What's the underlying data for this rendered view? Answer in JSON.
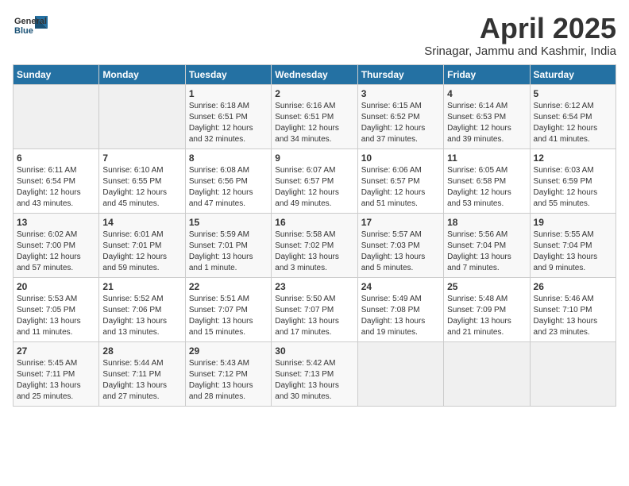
{
  "logo": {
    "general": "General",
    "blue": "Blue"
  },
  "title": "April 2025",
  "location": "Srinagar, Jammu and Kashmir, India",
  "weekdays": [
    "Sunday",
    "Monday",
    "Tuesday",
    "Wednesday",
    "Thursday",
    "Friday",
    "Saturday"
  ],
  "weeks": [
    [
      {
        "day": "",
        "detail": ""
      },
      {
        "day": "",
        "detail": ""
      },
      {
        "day": "1",
        "detail": "Sunrise: 6:18 AM\nSunset: 6:51 PM\nDaylight: 12 hours\nand 32 minutes."
      },
      {
        "day": "2",
        "detail": "Sunrise: 6:16 AM\nSunset: 6:51 PM\nDaylight: 12 hours\nand 34 minutes."
      },
      {
        "day": "3",
        "detail": "Sunrise: 6:15 AM\nSunset: 6:52 PM\nDaylight: 12 hours\nand 37 minutes."
      },
      {
        "day": "4",
        "detail": "Sunrise: 6:14 AM\nSunset: 6:53 PM\nDaylight: 12 hours\nand 39 minutes."
      },
      {
        "day": "5",
        "detail": "Sunrise: 6:12 AM\nSunset: 6:54 PM\nDaylight: 12 hours\nand 41 minutes."
      }
    ],
    [
      {
        "day": "6",
        "detail": "Sunrise: 6:11 AM\nSunset: 6:54 PM\nDaylight: 12 hours\nand 43 minutes."
      },
      {
        "day": "7",
        "detail": "Sunrise: 6:10 AM\nSunset: 6:55 PM\nDaylight: 12 hours\nand 45 minutes."
      },
      {
        "day": "8",
        "detail": "Sunrise: 6:08 AM\nSunset: 6:56 PM\nDaylight: 12 hours\nand 47 minutes."
      },
      {
        "day": "9",
        "detail": "Sunrise: 6:07 AM\nSunset: 6:57 PM\nDaylight: 12 hours\nand 49 minutes."
      },
      {
        "day": "10",
        "detail": "Sunrise: 6:06 AM\nSunset: 6:57 PM\nDaylight: 12 hours\nand 51 minutes."
      },
      {
        "day": "11",
        "detail": "Sunrise: 6:05 AM\nSunset: 6:58 PM\nDaylight: 12 hours\nand 53 minutes."
      },
      {
        "day": "12",
        "detail": "Sunrise: 6:03 AM\nSunset: 6:59 PM\nDaylight: 12 hours\nand 55 minutes."
      }
    ],
    [
      {
        "day": "13",
        "detail": "Sunrise: 6:02 AM\nSunset: 7:00 PM\nDaylight: 12 hours\nand 57 minutes."
      },
      {
        "day": "14",
        "detail": "Sunrise: 6:01 AM\nSunset: 7:01 PM\nDaylight: 12 hours\nand 59 minutes."
      },
      {
        "day": "15",
        "detail": "Sunrise: 5:59 AM\nSunset: 7:01 PM\nDaylight: 13 hours\nand 1 minute."
      },
      {
        "day": "16",
        "detail": "Sunrise: 5:58 AM\nSunset: 7:02 PM\nDaylight: 13 hours\nand 3 minutes."
      },
      {
        "day": "17",
        "detail": "Sunrise: 5:57 AM\nSunset: 7:03 PM\nDaylight: 13 hours\nand 5 minutes."
      },
      {
        "day": "18",
        "detail": "Sunrise: 5:56 AM\nSunset: 7:04 PM\nDaylight: 13 hours\nand 7 minutes."
      },
      {
        "day": "19",
        "detail": "Sunrise: 5:55 AM\nSunset: 7:04 PM\nDaylight: 13 hours\nand 9 minutes."
      }
    ],
    [
      {
        "day": "20",
        "detail": "Sunrise: 5:53 AM\nSunset: 7:05 PM\nDaylight: 13 hours\nand 11 minutes."
      },
      {
        "day": "21",
        "detail": "Sunrise: 5:52 AM\nSunset: 7:06 PM\nDaylight: 13 hours\nand 13 minutes."
      },
      {
        "day": "22",
        "detail": "Sunrise: 5:51 AM\nSunset: 7:07 PM\nDaylight: 13 hours\nand 15 minutes."
      },
      {
        "day": "23",
        "detail": "Sunrise: 5:50 AM\nSunset: 7:07 PM\nDaylight: 13 hours\nand 17 minutes."
      },
      {
        "day": "24",
        "detail": "Sunrise: 5:49 AM\nSunset: 7:08 PM\nDaylight: 13 hours\nand 19 minutes."
      },
      {
        "day": "25",
        "detail": "Sunrise: 5:48 AM\nSunset: 7:09 PM\nDaylight: 13 hours\nand 21 minutes."
      },
      {
        "day": "26",
        "detail": "Sunrise: 5:46 AM\nSunset: 7:10 PM\nDaylight: 13 hours\nand 23 minutes."
      }
    ],
    [
      {
        "day": "27",
        "detail": "Sunrise: 5:45 AM\nSunset: 7:11 PM\nDaylight: 13 hours\nand 25 minutes."
      },
      {
        "day": "28",
        "detail": "Sunrise: 5:44 AM\nSunset: 7:11 PM\nDaylight: 13 hours\nand 27 minutes."
      },
      {
        "day": "29",
        "detail": "Sunrise: 5:43 AM\nSunset: 7:12 PM\nDaylight: 13 hours\nand 28 minutes."
      },
      {
        "day": "30",
        "detail": "Sunrise: 5:42 AM\nSunset: 7:13 PM\nDaylight: 13 hours\nand 30 minutes."
      },
      {
        "day": "",
        "detail": ""
      },
      {
        "day": "",
        "detail": ""
      },
      {
        "day": "",
        "detail": ""
      }
    ]
  ]
}
